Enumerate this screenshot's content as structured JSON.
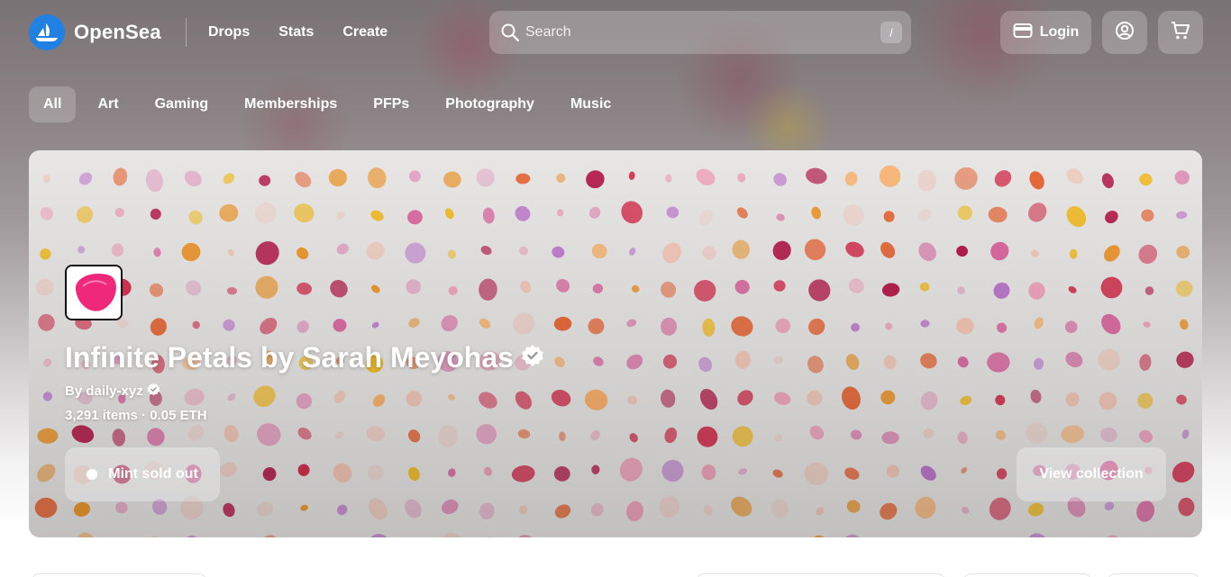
{
  "brand": {
    "name": "OpenSea",
    "logo_icon": "opensea-logo-icon",
    "accent": "#2081e2"
  },
  "nav": {
    "items": [
      "Drops",
      "Stats",
      "Create"
    ]
  },
  "search": {
    "placeholder": "Search",
    "shortcut": "/"
  },
  "header_actions": {
    "login_label": "Login",
    "login_icon": "wallet-icon",
    "profile_icon": "user-circle-icon",
    "cart_icon": "cart-icon"
  },
  "categories": {
    "items": [
      "All",
      "Art",
      "Gaming",
      "Memberships",
      "PFPs",
      "Photography",
      "Music"
    ],
    "active": "All"
  },
  "hero": {
    "title": "Infinite Petals by Sarah Meyohas",
    "creator": "By daily-xyz",
    "stats": "3,291 items · 0.05 ETH",
    "mint_status": "Mint sold out",
    "view_button": "View collection",
    "verified_icon": "verified-badge-icon",
    "petal_colors": [
      "#f4a6c1",
      "#e06aa4",
      "#b7194a",
      "#f29a2e",
      "#f7c12f",
      "#ec6b3b",
      "#f8c9b8",
      "#c27bd1",
      "#f3d7d0",
      "#d8304f",
      "#ffb46b",
      "#e9a9c9"
    ]
  }
}
